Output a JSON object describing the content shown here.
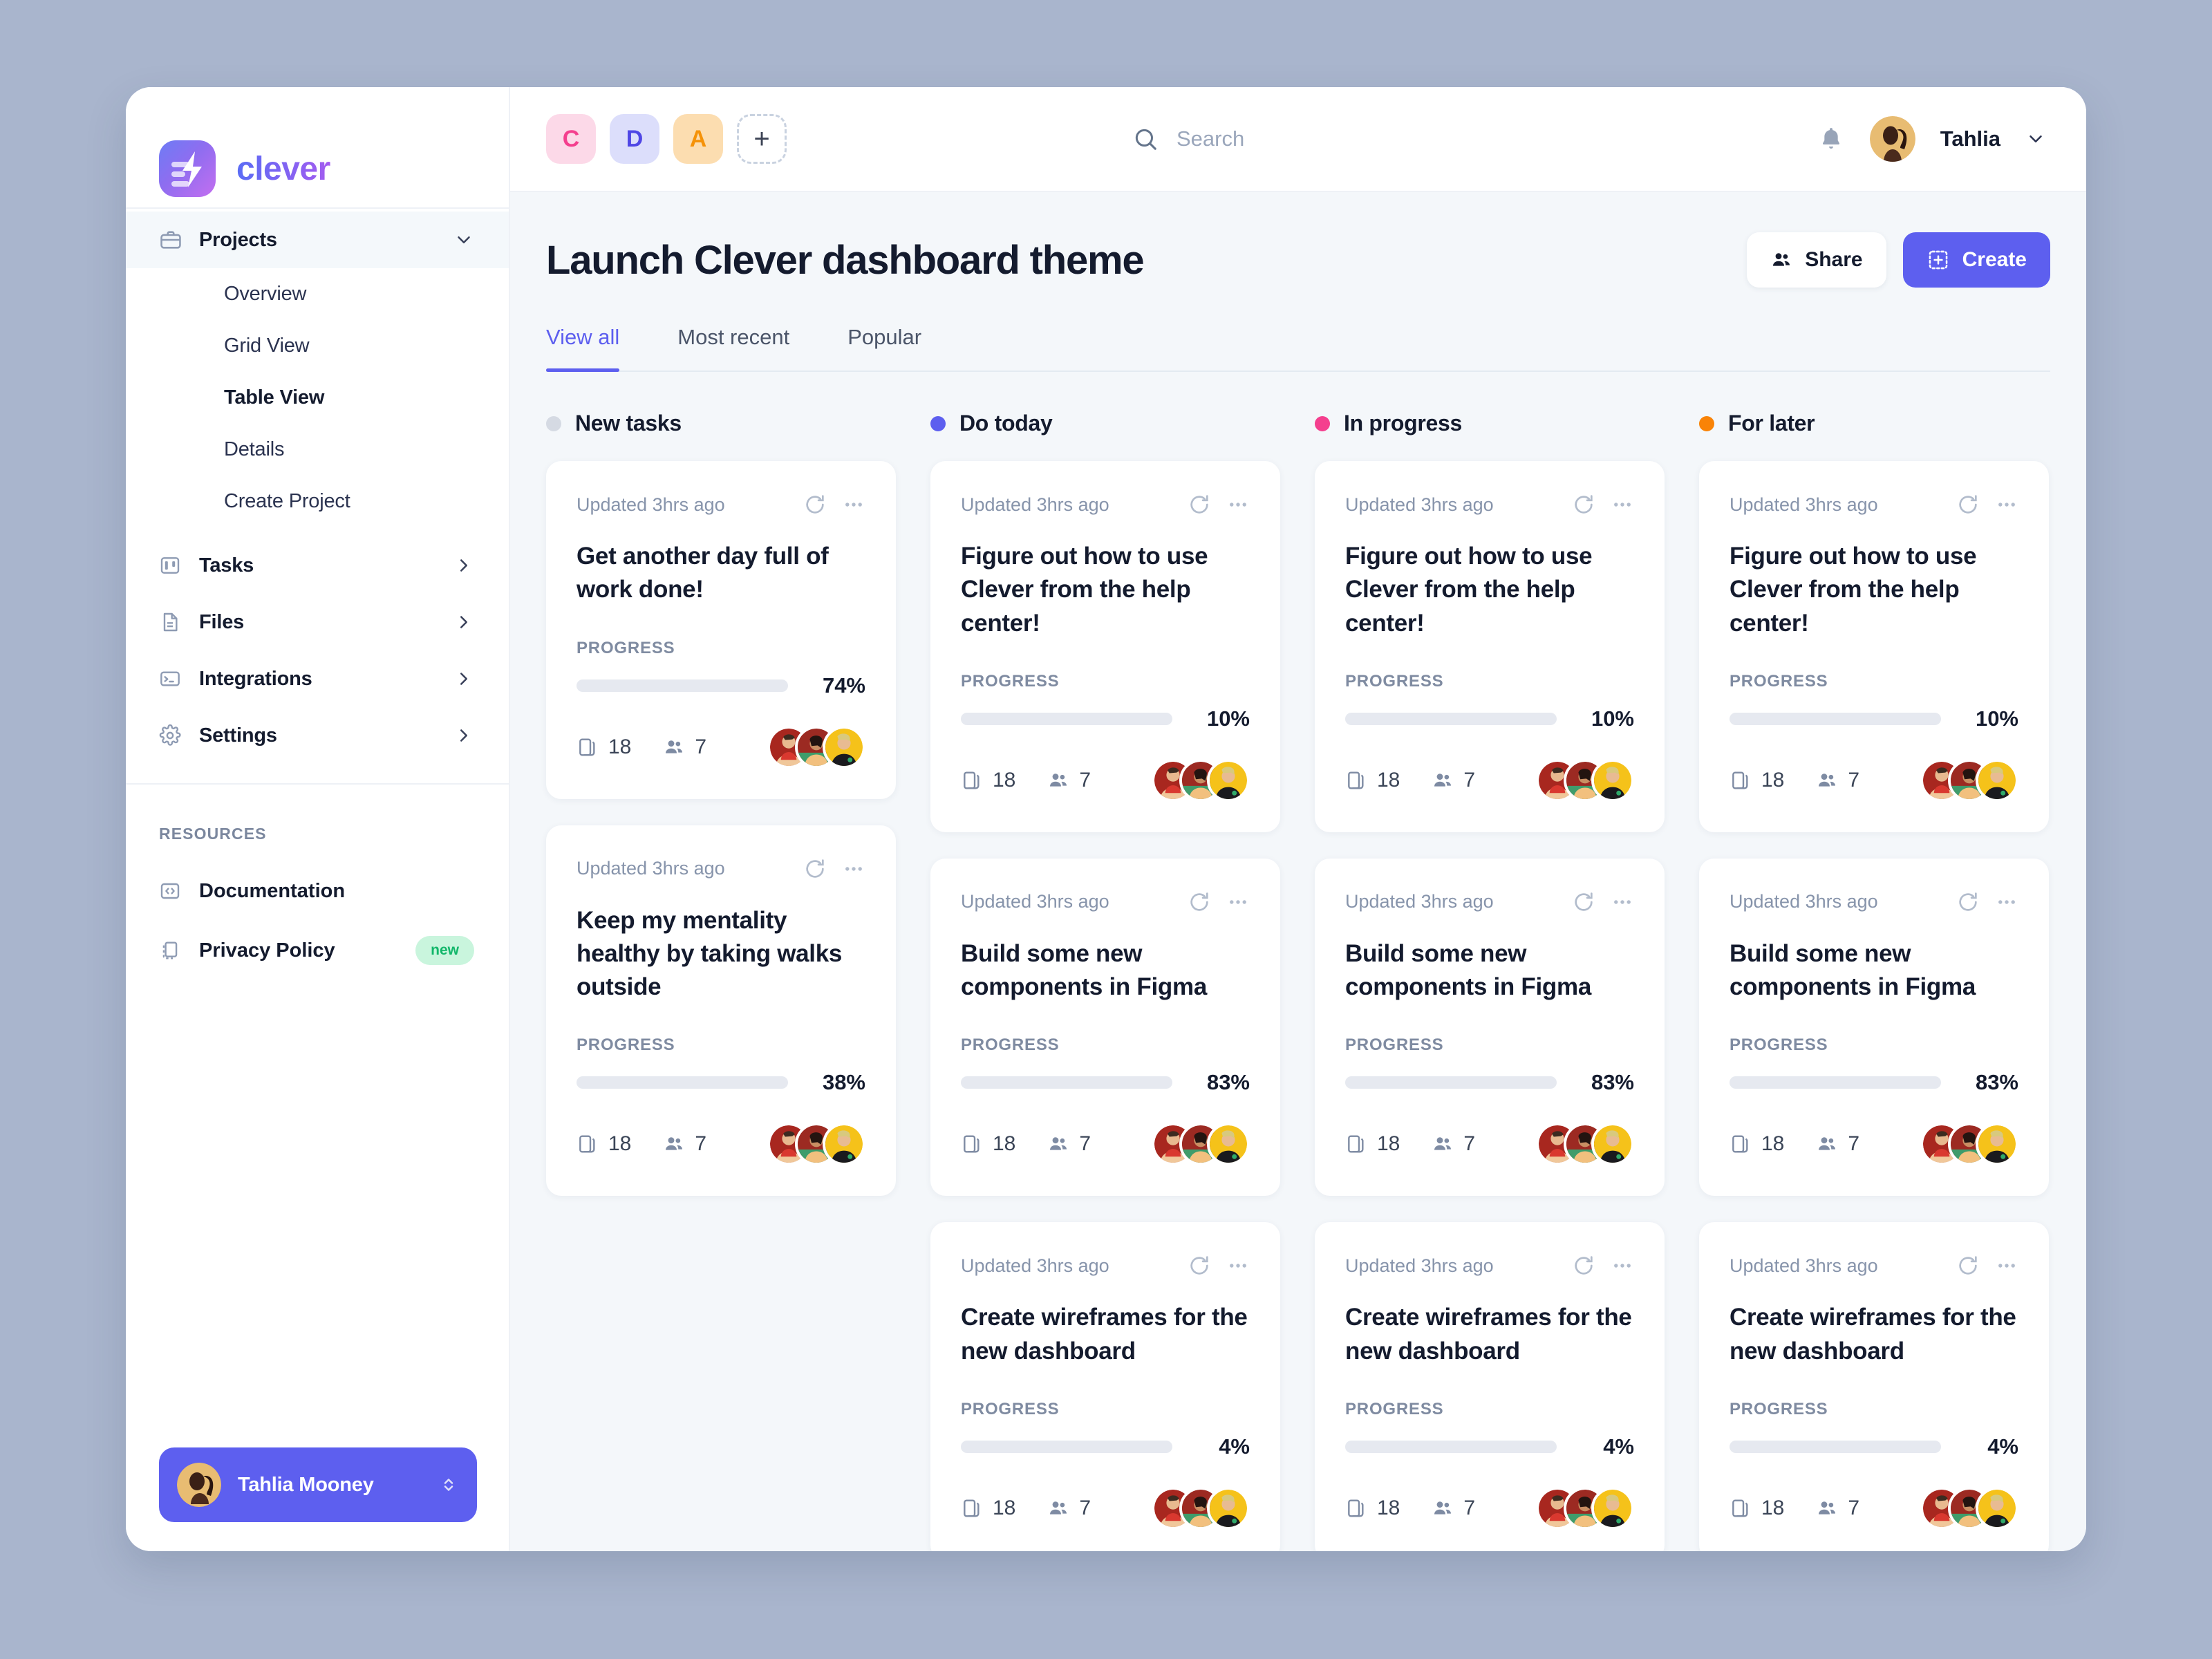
{
  "brand": {
    "name": "clever",
    "logo_icon": "lightning-list-icon"
  },
  "sidebar": {
    "projects": {
      "label": "Projects",
      "icon": "briefcase-icon",
      "chevron": "chevron-down-icon"
    },
    "sub_items": [
      {
        "label": "Overview"
      },
      {
        "label": "Grid View"
      },
      {
        "label": "Table View"
      },
      {
        "label": "Details"
      },
      {
        "label": "Create Project"
      }
    ],
    "nav_items": [
      {
        "label": "Tasks",
        "icon": "kanban-icon"
      },
      {
        "label": "Files",
        "icon": "document-icon"
      },
      {
        "label": "Integrations",
        "icon": "terminal-icon"
      },
      {
        "label": "Settings",
        "icon": "gear-icon"
      }
    ],
    "resources_header": "RESOURCES",
    "resources": [
      {
        "label": "Documentation",
        "icon": "code-brackets-icon",
        "badge": ""
      },
      {
        "label": "Privacy Policy",
        "icon": "copy-pages-icon",
        "badge": "new"
      }
    ],
    "user": {
      "name": "Tahlia Mooney",
      "selector_icon": "chevron-up-down-icon"
    }
  },
  "topbar": {
    "workspace_chips": [
      {
        "letter": "C",
        "bg": "#fcd9e8",
        "fg": "#f43f8e"
      },
      {
        "letter": "D",
        "bg": "#dcdefb",
        "fg": "#4f46e5"
      },
      {
        "letter": "A",
        "bg": "#fcddb0",
        "fg": "#f59208"
      }
    ],
    "add_chip": "+",
    "search": {
      "placeholder": "Search",
      "value": "",
      "icon": "search-icon"
    },
    "bell_icon": "bell-icon",
    "user_name": "Tahlia",
    "user_chevron": "chevron-down-icon"
  },
  "page": {
    "title": "Launch Clever dashboard theme",
    "share_label": "Share",
    "share_icon": "people-icon",
    "create_label": "Create",
    "create_icon": "dashed-square-plus-icon",
    "tabs": [
      {
        "label": "View all",
        "active": true
      },
      {
        "label": "Most recent",
        "active": false
      },
      {
        "label": "Popular",
        "active": false
      }
    ]
  },
  "colors": {
    "accent": "#5d5fef",
    "green": "#17c26d",
    "orange": "#f98307",
    "pink": "#f43f68",
    "gray_dot": "#d5dae3"
  },
  "board": {
    "progress_label": "PROGRESS",
    "updated_text": "Updated 3hrs ago",
    "refresh_icon": "refresh-icon",
    "more_icon": "more-horizontal-icon",
    "docs_icon": "copy-pages-icon",
    "members_icon": "people-icon",
    "columns": [
      {
        "title": "New tasks",
        "dot_color": "#d5dae3",
        "cards": [
          {
            "updated": "Updated 3hrs ago",
            "title": "Get another day full of work done!",
            "progress_label": "PROGRESS",
            "progress": 74,
            "progress_text": "74%",
            "bar_color": "#17c26d",
            "docs": "18",
            "members": "7"
          },
          {
            "updated": "Updated 3hrs ago",
            "title": "Keep my mentality healthy by taking walks outside",
            "progress_label": "PROGRESS",
            "progress": 38,
            "progress_text": "38%",
            "bar_color": "#f98307",
            "docs": "18",
            "members": "7"
          }
        ]
      },
      {
        "title": "Do today",
        "dot_color": "#5d5fef",
        "cards": [
          {
            "updated": "Updated 3hrs ago",
            "title": "Figure out how to use Clever from the help center!",
            "progress_label": "PROGRESS",
            "progress": 10,
            "progress_text": "10%",
            "bar_color": "#5d5fef",
            "docs": "18",
            "members": "7"
          },
          {
            "updated": "Updated 3hrs ago",
            "title": "Build some new components in Figma",
            "progress_label": "PROGRESS",
            "progress": 83,
            "progress_text": "83%",
            "bar_color": "#17c26d",
            "docs": "18",
            "members": "7"
          },
          {
            "updated": "Updated 3hrs ago",
            "title": "Create wireframes for the new dashboard",
            "progress_label": "PROGRESS",
            "progress": 4,
            "progress_text": "4%",
            "bar_color": "#f43f68",
            "docs": "18",
            "members": "7"
          }
        ]
      },
      {
        "title": "In progress",
        "dot_color": "#f43f8e",
        "cards": [
          {
            "updated": "Updated 3hrs ago",
            "title": "Figure out how to use Clever from the help center!",
            "progress_label": "PROGRESS",
            "progress": 10,
            "progress_text": "10%",
            "bar_color": "#5d5fef",
            "docs": "18",
            "members": "7"
          },
          {
            "updated": "Updated 3hrs ago",
            "title": "Build some new components in Figma",
            "progress_label": "PROGRESS",
            "progress": 83,
            "progress_text": "83%",
            "bar_color": "#17c26d",
            "docs": "18",
            "members": "7"
          },
          {
            "updated": "Updated 3hrs ago",
            "title": "Create wireframes for the new dashboard",
            "progress_label": "PROGRESS",
            "progress": 4,
            "progress_text": "4%",
            "bar_color": "#f43f68",
            "docs": "18",
            "members": "7"
          }
        ]
      },
      {
        "title": "For later",
        "dot_color": "#f98307",
        "cards": [
          {
            "updated": "Updated 3hrs ago",
            "title": "Figure out how to use Clever from the help center!",
            "progress_label": "PROGRESS",
            "progress": 10,
            "progress_text": "10%",
            "bar_color": "#5d5fef",
            "docs": "18",
            "members": "7"
          },
          {
            "updated": "Updated 3hrs ago",
            "title": "Build some new components in Figma",
            "progress_label": "PROGRESS",
            "progress": 83,
            "progress_text": "83%",
            "bar_color": "#17c26d",
            "docs": "18",
            "members": "7"
          },
          {
            "updated": "Updated 3hrs ago",
            "title": "Create wireframes for the new dashboard",
            "progress_label": "PROGRESS",
            "progress": 4,
            "progress_text": "4%",
            "bar_color": "#f43f68",
            "docs": "18",
            "members": "7"
          }
        ]
      }
    ]
  }
}
